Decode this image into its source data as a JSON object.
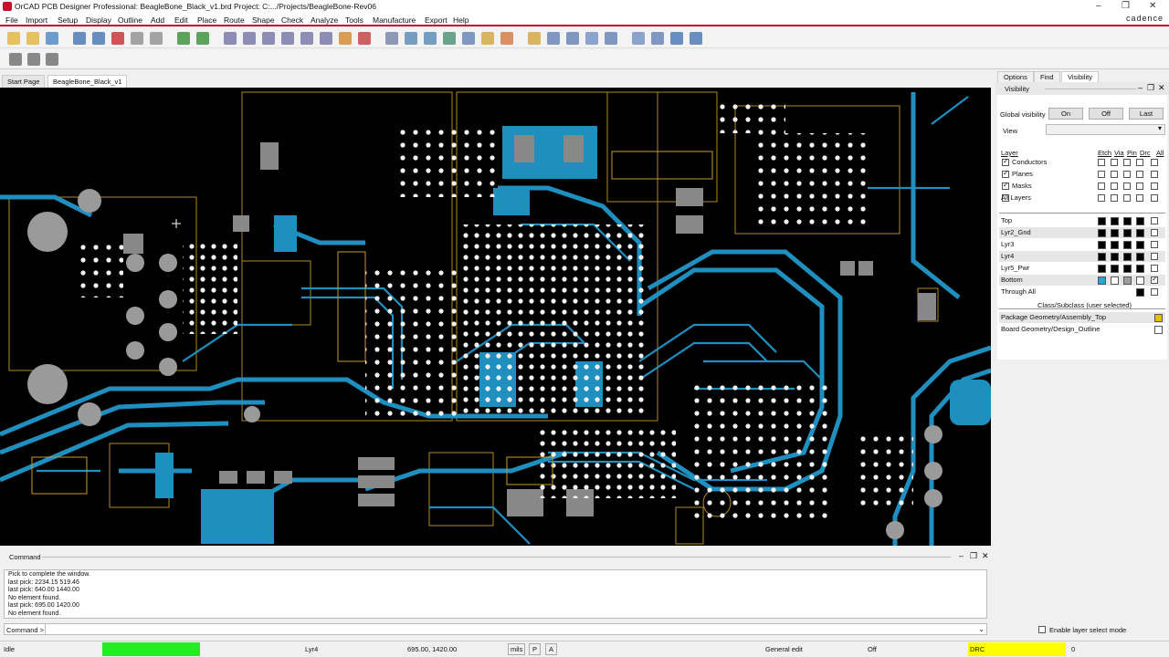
{
  "window": {
    "title": "OrCAD PCB Designer Professional: BeagleBone_Black_v1.brd  Project: C:.../Projects/BeagleBone-Rev06",
    "brand": "cadence"
  },
  "menu": [
    "File",
    "Import",
    "Setup",
    "Display",
    "Outline",
    "Add",
    "Edit",
    "Place",
    "Route",
    "Shape",
    "Check",
    "Analyze",
    "Tools",
    "Manufacture",
    "Export",
    "Help"
  ],
  "tabs": [
    {
      "label": "Start Page",
      "active": false
    },
    {
      "label": "BeagleBone_Black_v1",
      "active": true
    }
  ],
  "command": {
    "title": "Command",
    "log": [
      "Pick to complete the window.",
      "last pick:  2234.15 519.46",
      "last pick:  640.00 1440.00",
      "No element found.",
      "last pick:  695.00 1420.00",
      "No element found."
    ],
    "prompt": "Command >"
  },
  "panel": {
    "tabs": [
      "Options",
      "Find",
      "Visibility"
    ],
    "active_tab": "Visibility",
    "header": "Visibility",
    "global_visibility_label": "Global visibility",
    "buttons": [
      "On",
      "Off",
      "Last"
    ],
    "view_label": "View",
    "view_value": "",
    "layer_header": "Layer",
    "col_headers": [
      "Etch",
      "Via",
      "Pin",
      "Drc",
      "All"
    ],
    "layer_groups": [
      {
        "label": "Conductors",
        "checked": true
      },
      {
        "label": "Planes",
        "checked": true
      },
      {
        "label": "Masks",
        "checked": true
      },
      {
        "label": "All Layers",
        "checked": false
      }
    ],
    "layers": [
      {
        "label": "Top",
        "colors": [
          "#000000",
          "#000000",
          "#000000",
          "#000000"
        ]
      },
      {
        "label": "Lyr2_Gnd",
        "colors": [
          "#000000",
          "#000000",
          "#000000",
          "#000000"
        ]
      },
      {
        "label": "Lyr3",
        "colors": [
          "#000000",
          "#000000",
          "#000000",
          "#000000"
        ]
      },
      {
        "label": "Lyr4",
        "colors": [
          "#000000",
          "#000000",
          "#000000",
          "#000000"
        ]
      },
      {
        "label": "Lyr5_Pwr",
        "colors": [
          "#000000",
          "#000000",
          "#000000",
          "#000000"
        ]
      },
      {
        "label": "Bottom",
        "colors": [
          "#29a3d6",
          "#ffffff",
          "#9e9e9e",
          "#ffffff"
        ],
        "all_checked": true
      },
      {
        "label": "Through All",
        "colors": [
          "#000000"
        ]
      }
    ],
    "subclass_header": "Class/Subclass (user selected)",
    "subclasses": [
      {
        "label": "Package Geometry/Assembly_Top",
        "color": "#e0c000"
      },
      {
        "label": "Board Geometry/Design_Outline",
        "color": "#ffffff"
      }
    ],
    "enable_layer_select": "Enable layer select mode"
  },
  "status": {
    "state": "Idle",
    "indicator_color": "#22ee22",
    "layer": "Lyr4",
    "coords": "695.00, 1420.00",
    "units": "mils",
    "p": "P",
    "a": "A",
    "mode": "General edit",
    "off": "Off",
    "drc": "DRC",
    "drc_color": "#ffff00",
    "drc_count": "0"
  }
}
